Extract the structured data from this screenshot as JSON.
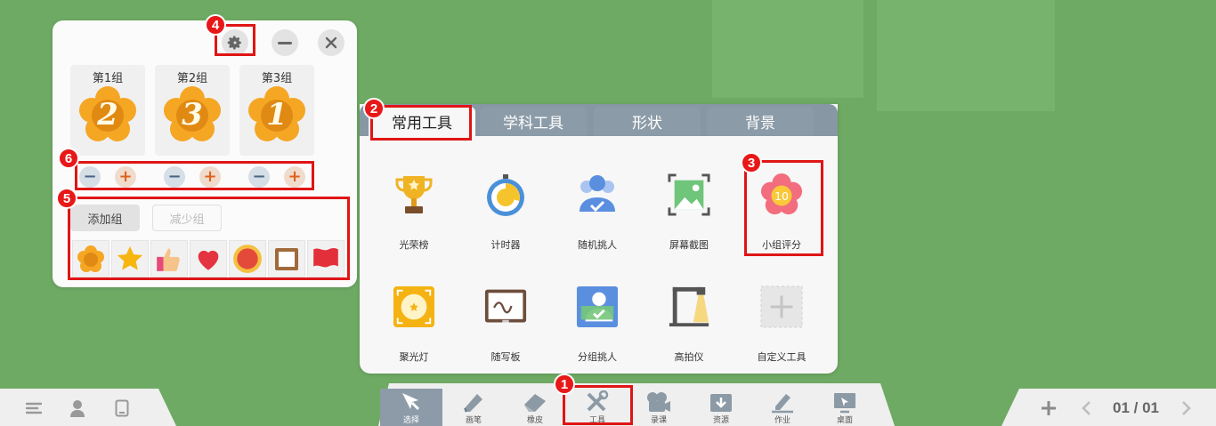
{
  "score_panel": {
    "settings_icon": "gear-icon",
    "minimize_icon": "minus-icon",
    "close_icon": "close-icon",
    "groups": [
      {
        "name": "第1组",
        "score": "2"
      },
      {
        "name": "第2组",
        "score": "3"
      },
      {
        "name": "第3组",
        "score": "1"
      }
    ],
    "add_group_label": "添加组",
    "remove_group_label": "减少组",
    "reward_icons": [
      "flower-icon",
      "star-icon",
      "thumbs-up-icon",
      "heart-icon",
      "medal-icon",
      "certificate-icon",
      "flag-icon"
    ]
  },
  "tool_panel": {
    "tabs": [
      {
        "label": "常用工具",
        "active": true
      },
      {
        "label": "学科工具",
        "active": false
      },
      {
        "label": "形状",
        "active": false
      },
      {
        "label": "背景",
        "active": false
      }
    ],
    "tools": [
      {
        "label": "光荣榜",
        "icon": "trophy-icon"
      },
      {
        "label": "计时器",
        "icon": "timer-icon"
      },
      {
        "label": "随机挑人",
        "icon": "random-pick-icon"
      },
      {
        "label": "屏幕截图",
        "icon": "screenshot-icon"
      },
      {
        "label": "小组评分",
        "icon": "group-score-icon",
        "badge": "10"
      },
      {
        "label": "聚光灯",
        "icon": "spotlight-icon"
      },
      {
        "label": "随写板",
        "icon": "writing-board-icon"
      },
      {
        "label": "分组挑人",
        "icon": "group-pick-icon"
      },
      {
        "label": "高拍仪",
        "icon": "document-camera-icon"
      },
      {
        "label": "自定义工具",
        "icon": "add-icon"
      }
    ]
  },
  "bottom_bar": {
    "left_icons": [
      "menu-icon",
      "user-icon",
      "tablet-icon"
    ],
    "buttons": [
      {
        "label": "选择",
        "icon": "cursor-icon",
        "active": true
      },
      {
        "label": "画笔",
        "icon": "pen-icon"
      },
      {
        "label": "橡皮",
        "icon": "eraser-icon"
      },
      {
        "label": "工具",
        "icon": "tools-icon"
      },
      {
        "label": "录课",
        "icon": "video-camera-icon"
      },
      {
        "label": "资源",
        "icon": "resource-icon"
      },
      {
        "label": "作业",
        "icon": "homework-icon"
      },
      {
        "label": "桌面",
        "icon": "desktop-icon"
      }
    ],
    "page_indicator": "01 / 01"
  },
  "annotations": [
    "1",
    "2",
    "3",
    "4",
    "5",
    "6"
  ],
  "colors": {
    "background": "#6eaa64",
    "highlight": "#e01515",
    "flower": "#f5a623",
    "tab_strip": "#8797a3"
  }
}
